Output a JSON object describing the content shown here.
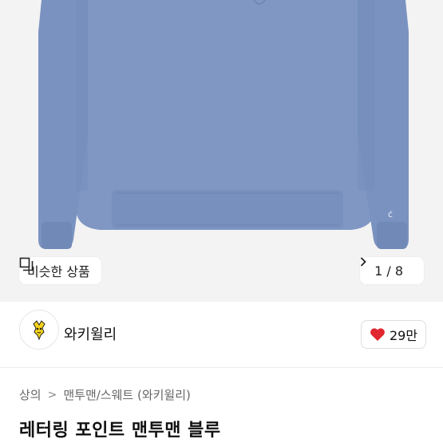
{
  "gallery": {
    "similar_label": "비슷한 상품",
    "similar_icon": "similar-items-icon",
    "counter": "1 / 8",
    "next_icon": "chevron-right-icon",
    "product_color": "#7f97c6"
  },
  "seller": {
    "name": "와키윌리",
    "avatar_icon": "dog-logo-icon",
    "like_count": "29만",
    "like_icon": "heart-icon",
    "like_color": "#e0262e"
  },
  "breadcrumb": {
    "category": "상의",
    "separator": ">",
    "subcategory": "맨투맨/스웨트 (와키윌리)"
  },
  "product": {
    "title": "레터링 포인트 맨투맨 블루"
  }
}
